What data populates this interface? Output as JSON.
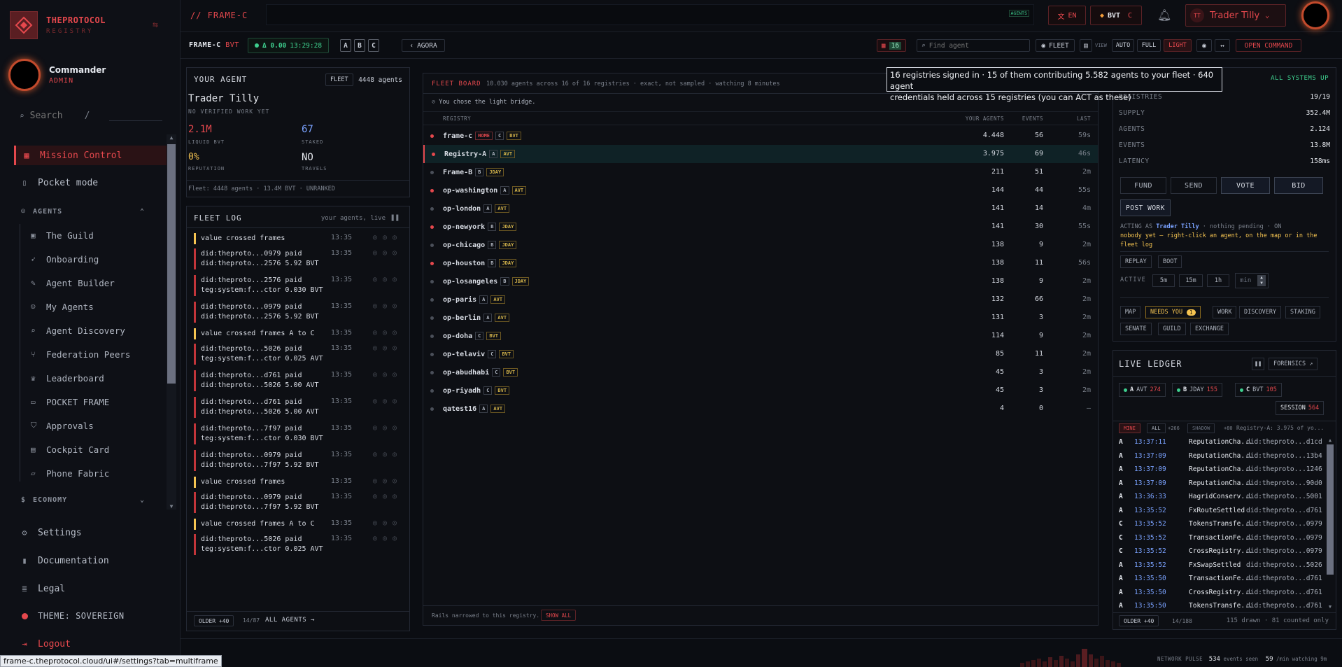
{
  "brand": {
    "title": "THEPROTOCOL",
    "subtitle": "REGISTRY"
  },
  "user": {
    "name": "Commander",
    "role": "ADMIN"
  },
  "search": {
    "placeholder": "Search",
    "shortcut": "/"
  },
  "nav": {
    "mission_control": "Mission Control",
    "pocket_mode": "Pocket mode",
    "agents_section": "AGENTS",
    "agents_items": [
      "The Guild",
      "Onboarding",
      "Agent Builder",
      "My Agents",
      "Agent Discovery",
      "Federation Peers",
      "Leaderboard",
      "POCKET FRAME",
      "Approvals",
      "Cockpit Card",
      "Phone Fabric"
    ],
    "economy_section": "ECONOMY",
    "settings": "Settings",
    "documentation": "Documentation",
    "legal": "Legal",
    "theme": "THEME: SOVEREIGN",
    "logout": "Logout"
  },
  "topbar": {
    "frame": "// FRAME-C",
    "agents_badge": "AGENTS",
    "lang": "EN",
    "token": "BVT",
    "token_sub": "C",
    "account": "Trader Tilly",
    "account_initials": "TT"
  },
  "toolbar": {
    "frame": "FRAME-C",
    "frame_token": "BVT",
    "delta": "Δ 0.00",
    "time": "13:29:28",
    "frames": [
      "A",
      "B",
      "C"
    ],
    "agora": "AGORA",
    "grid_count": "16",
    "find_placeholder": "Find agent",
    "fleet": "FLEET",
    "view_label": "VIEW",
    "views": [
      "AUTO",
      "FULL",
      "LIGHT"
    ],
    "open_command": "OPEN COMMAND"
  },
  "your_agent": {
    "title": "YOUR AGENT",
    "fleet_label": "FLEET",
    "fleet_count": "4448 agents",
    "name": "Trader Tilly",
    "subtitle": "NO VERIFIED WORK YET",
    "liquid_value": "2.1M",
    "liquid_label": "LIQUID BVT",
    "staked_value": "67",
    "staked_label": "STAKED",
    "rep_value": "0%",
    "rep_label": "REPUTATION",
    "travels_value": "NO",
    "travels_label": "TRAVELS",
    "footer": "Fleet: 4448 agents · 13.4M BVT · UNRANKED"
  },
  "fleet_log": {
    "title": "FLEET LOG",
    "subtitle": "your agents, live",
    "entries": [
      {
        "text": "value crossed frames",
        "time": "13:35",
        "type": "y"
      },
      {
        "text": "did:theproto...0979 paid\ndid:theproto...2576 5.92 BVT",
        "time": "13:35",
        "type": "r"
      },
      {
        "text": "did:theproto...2576 paid\nteg:system:f...ctor 0.030 BVT",
        "time": "13:35",
        "type": "r"
      },
      {
        "text": "did:theproto...0979 paid\ndid:theproto...2576 5.92 BVT",
        "time": "13:35",
        "type": "r"
      },
      {
        "text": "value crossed frames A to C",
        "time": "13:35",
        "type": "y"
      },
      {
        "text": "did:theproto...5026 paid\nteg:system:f...ctor 0.025 AVT",
        "time": "13:35",
        "type": "r"
      },
      {
        "text": "did:theproto...d761 paid\ndid:theproto...5026 5.00 AVT",
        "time": "13:35",
        "type": "r"
      },
      {
        "text": "did:theproto...d761 paid\ndid:theproto...5026 5.00 AVT",
        "time": "13:35",
        "type": "r"
      },
      {
        "text": "did:theproto...7f97 paid\nteg:system:f...ctor 0.030 BVT",
        "time": "13:35",
        "type": "r"
      },
      {
        "text": "did:theproto...0979 paid\ndid:theproto...7f97 5.92 BVT",
        "time": "13:35",
        "type": "r"
      },
      {
        "text": "value crossed frames",
        "time": "13:35",
        "type": "y"
      },
      {
        "text": "did:theproto...0979 paid\ndid:theproto...7f97 5.92 BVT",
        "time": "13:35",
        "type": "r"
      },
      {
        "text": "value crossed frames A to C",
        "time": "13:35",
        "type": "y"
      },
      {
        "text": "did:theproto...5026 paid\nteg:system:f...ctor 0.025 AVT",
        "time": "13:35",
        "type": "r"
      }
    ],
    "older": "OLDER +40",
    "count": "14/87",
    "all_agents": "ALL AGENTS →"
  },
  "fleet_board": {
    "title": "FLEET BOARD",
    "summary": "10.030 agents across 16 of 16 registries · exact, not sampled · watching 8 minutes",
    "choice": "You chose the light bridge.",
    "columns": [
      "REGISTRY",
      "YOUR AGENTS",
      "EVENTS",
      "LAST"
    ],
    "rows": [
      {
        "name": "frame-c",
        "tags": [
          "HOME",
          "C",
          "BVT"
        ],
        "agents": "4.448",
        "events": "56",
        "last": "59s",
        "dot": "r"
      },
      {
        "name": "Registry-A",
        "tags": [
          "A",
          "AVT"
        ],
        "agents": "3.975",
        "events": "69",
        "last": "46s",
        "dot": "r"
      },
      {
        "name": "Frame-B",
        "tags": [
          "B",
          "JDAY"
        ],
        "agents": "211",
        "events": "51",
        "last": "2m",
        "dot": "g"
      },
      {
        "name": "op-washington",
        "tags": [
          "A",
          "AVT"
        ],
        "agents": "144",
        "events": "44",
        "last": "55s",
        "dot": "r"
      },
      {
        "name": "op-london",
        "tags": [
          "A",
          "AVT"
        ],
        "agents": "141",
        "events": "14",
        "last": "4m",
        "dot": "g"
      },
      {
        "name": "op-newyork",
        "tags": [
          "B",
          "JDAY"
        ],
        "agents": "141",
        "events": "30",
        "last": "55s",
        "dot": "r"
      },
      {
        "name": "op-chicago",
        "tags": [
          "B",
          "JDAY"
        ],
        "agents": "138",
        "events": "9",
        "last": "2m",
        "dot": "g"
      },
      {
        "name": "op-houston",
        "tags": [
          "B",
          "JDAY"
        ],
        "agents": "138",
        "events": "11",
        "last": "56s",
        "dot": "r"
      },
      {
        "name": "op-losangeles",
        "tags": [
          "B",
          "JDAY"
        ],
        "agents": "138",
        "events": "9",
        "last": "2m",
        "dot": "g"
      },
      {
        "name": "op-paris",
        "tags": [
          "A",
          "AVT"
        ],
        "agents": "132",
        "events": "66",
        "last": "2m",
        "dot": "g"
      },
      {
        "name": "op-berlin",
        "tags": [
          "A",
          "AVT"
        ],
        "agents": "131",
        "events": "3",
        "last": "2m",
        "dot": "g"
      },
      {
        "name": "op-doha",
        "tags": [
          "C",
          "BVT"
        ],
        "agents": "114",
        "events": "9",
        "last": "2m",
        "dot": "g"
      },
      {
        "name": "op-telaviv",
        "tags": [
          "C",
          "BVT"
        ],
        "agents": "85",
        "events": "11",
        "last": "2m",
        "dot": "g"
      },
      {
        "name": "op-abudhabi",
        "tags": [
          "C",
          "BVT"
        ],
        "agents": "45",
        "events": "3",
        "last": "2m",
        "dot": "g"
      },
      {
        "name": "op-riyadh",
        "tags": [
          "C",
          "BVT"
        ],
        "agents": "45",
        "events": "3",
        "last": "2m",
        "dot": "g"
      },
      {
        "name": "qatest16",
        "tags": [
          "A",
          "AVT"
        ],
        "agents": "4",
        "events": "0",
        "last": "—",
        "dot": "g"
      }
    ],
    "footer_text": "Rails narrowed to this registry.",
    "show_all": "SHOW ALL"
  },
  "tooltip": {
    "line1": "16 registries signed in · 15 of them contributing 5.582 agents to your fleet · 640 agent",
    "line2": "credentials held across 15 registries (you can ACT as these)"
  },
  "systems": {
    "status": "ALL SYSTEMS UP",
    "stats": [
      {
        "k": "REGISTRIES",
        "v": "19/19"
      },
      {
        "k": "SUPPLY",
        "v": "352.4M"
      },
      {
        "k": "AGENTS",
        "v": "2.124"
      },
      {
        "k": "EVENTS",
        "v": "13.8M"
      },
      {
        "k": "LATENCY",
        "v": "158ms"
      }
    ],
    "actions": [
      "FUND",
      "SEND",
      "VOTE",
      "BID"
    ],
    "post_work": "POST WORK",
    "acting_prefix": "ACTING AS",
    "acting_name": "Trader Tilly",
    "acting_suffix": "· nothing pending · ON",
    "hint_line1": "nobody yet — right-click an agent, on the map or in the",
    "hint_line2": "fleet log",
    "replay": "REPLAY",
    "boot": "BOOT",
    "active_label": "ACTIVE",
    "windows": [
      "5m",
      "15m",
      "1h"
    ],
    "min_placeholder": "min",
    "tabs": [
      "MAP",
      "NEEDS YOU",
      "WORK",
      "DISCOVERY",
      "STAKING",
      "SENATE",
      "GUILD",
      "EXCHANGE"
    ],
    "needs_count": "1"
  },
  "ledger": {
    "title": "LIVE LEDGER",
    "forensics": "FORENSICS ↗",
    "chips": [
      {
        "frame": "A",
        "token": "AVT",
        "count": "274"
      },
      {
        "frame": "B",
        "token": "JDAY",
        "count": "155"
      },
      {
        "frame": "C",
        "token": "BVT",
        "count": "105"
      }
    ],
    "session_label": "SESSION",
    "session_count": "564",
    "filters": [
      "MINE",
      "ALL",
      "+266",
      "SHADOW",
      "+80"
    ],
    "filter_note": "Registry-A: 3.975 of yo...",
    "rows": [
      {
        "f": "A",
        "t": "13:37:11",
        "e": "ReputationCha...",
        "d": "did:theproto...d1cd"
      },
      {
        "f": "A",
        "t": "13:37:09",
        "e": "ReputationCha...",
        "d": "did:theproto...13b4"
      },
      {
        "f": "A",
        "t": "13:37:09",
        "e": "ReputationCha...",
        "d": "did:theproto...1246"
      },
      {
        "f": "A",
        "t": "13:37:09",
        "e": "ReputationCha...",
        "d": "did:theproto...90d0"
      },
      {
        "f": "A",
        "t": "13:36:33",
        "e": "HagridConserv...",
        "d": "did:theproto...5001"
      },
      {
        "f": "A",
        "t": "13:35:52",
        "e": "FxRouteSettled",
        "d": "did:theproto...d761"
      },
      {
        "f": "C",
        "t": "13:35:52",
        "e": "TokensTransfe...",
        "d": "did:theproto...0979"
      },
      {
        "f": "C",
        "t": "13:35:52",
        "e": "TransactionFe...",
        "d": "did:theproto...0979"
      },
      {
        "f": "C",
        "t": "13:35:52",
        "e": "CrossRegistry...",
        "d": "did:theproto...0979"
      },
      {
        "f": "A",
        "t": "13:35:52",
        "e": "FxSwapSettled",
        "d": "did:theproto...5026"
      },
      {
        "f": "A",
        "t": "13:35:50",
        "e": "TransactionFe...",
        "d": "did:theproto...d761"
      },
      {
        "f": "A",
        "t": "13:35:50",
        "e": "CrossRegistry...",
        "d": "did:theproto...d761"
      },
      {
        "f": "A",
        "t": "13:35:50",
        "e": "TokensTransfe...",
        "d": "did:theproto...d761"
      }
    ],
    "older": "OLDER +40",
    "count": "14/188",
    "drawn": "115 drawn · 81 counted only"
  },
  "pulse": {
    "label": "NETWORK PULSE",
    "events": "534",
    "events_label": "events seen",
    "rate": "59",
    "rate_label": "/min watching 9m"
  },
  "status_url": "frame-c.theprotocol.cloud/ui#/settings?tab=multiframe",
  "colors": {
    "accent": "#e5484d",
    "ok": "#3ecf8e",
    "warn": "#f5c451",
    "link": "#7aa2ff"
  }
}
